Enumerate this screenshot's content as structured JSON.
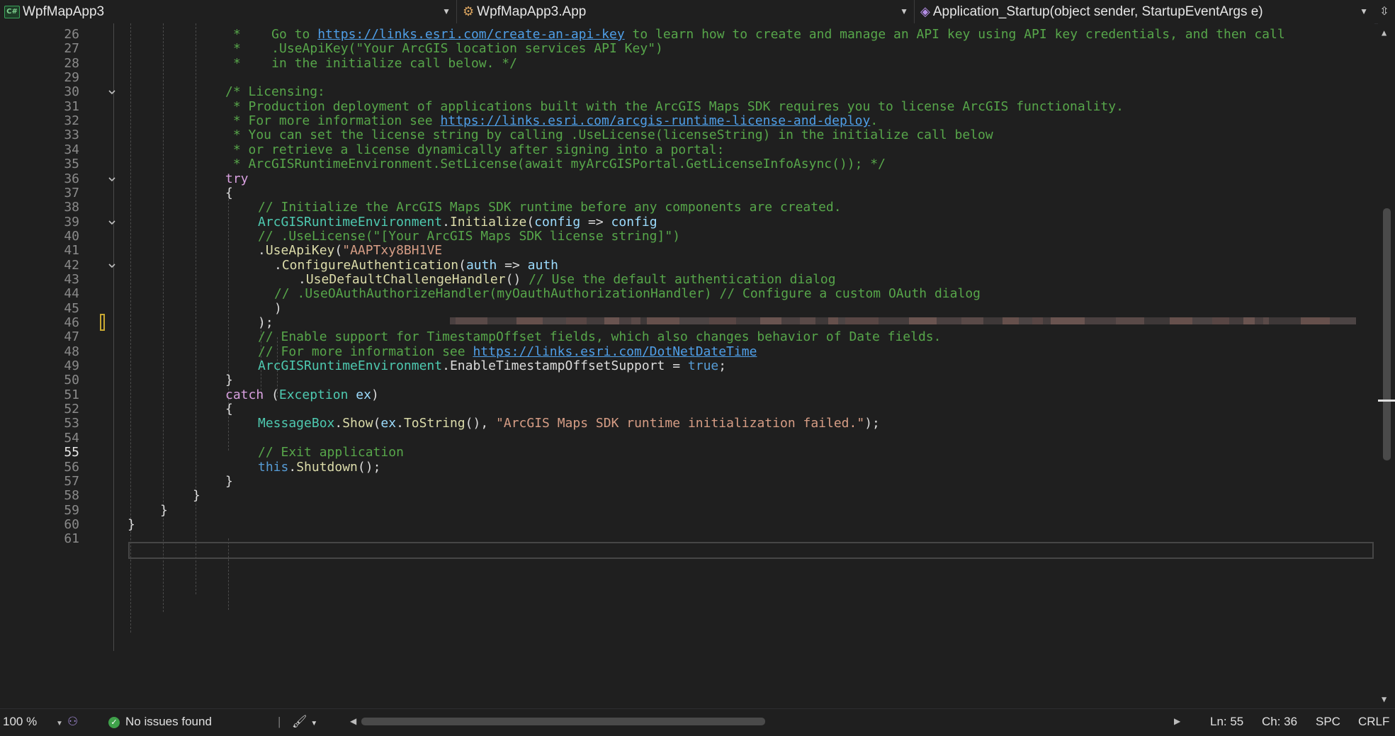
{
  "navbar": {
    "project": "WpfMapApp3",
    "project_icon": "C#",
    "class": "WpfMapApp3.App",
    "member": "Application_Startup(object sender, StartupEventArgs e)"
  },
  "lines": [
    {
      "n": "26",
      "text": "*    Go to https://links.esri.com/create-an-api-key to learn how to create and manage an API key using API key credentials, and then call"
    },
    {
      "n": "27",
      "text": "*    .UseApiKey(\"Your ArcGIS location services API Key\")"
    },
    {
      "n": "28",
      "text": "*    in the initialize call below. */"
    },
    {
      "n": "29",
      "text": ""
    },
    {
      "n": "30",
      "text": "/* Licensing:"
    },
    {
      "n": "31",
      "text": " * Production deployment of applications built with the ArcGIS Maps SDK requires you to license ArcGIS functionality."
    },
    {
      "n": "32",
      "text": " * For more information see https://links.esri.com/arcgis-runtime-license-and-deploy."
    },
    {
      "n": "33",
      "text": " * You can set the license string by calling .UseLicense(licenseString) in the initialize call below"
    },
    {
      "n": "34",
      "text": " * or retrieve a license dynamically after signing into a portal:"
    },
    {
      "n": "35",
      "text": " * ArcGISRuntimeEnvironment.SetLicense(await myArcGISPortal.GetLicenseInfoAsync()); */"
    },
    {
      "n": "36",
      "text": "try"
    },
    {
      "n": "37",
      "text": "{"
    },
    {
      "n": "38",
      "text": "// Initialize the ArcGIS Maps SDK runtime before any components are created."
    },
    {
      "n": "39",
      "text": "ArcGISRuntimeEnvironment.Initialize(config => config"
    },
    {
      "n": "40",
      "text": "// .UseLicense(\"[Your ArcGIS Maps SDK license string]\")"
    },
    {
      "n": "41",
      "text": ".UseApiKey(\"AAPTxy8BH1VE"
    },
    {
      "n": "42",
      "text": ".ConfigureAuthentication(auth => auth"
    },
    {
      "n": "43",
      "text": ".UseDefaultChallengeHandler() // Use the default authentication dialog"
    },
    {
      "n": "44",
      "text": "// .UseOAuthAuthorizeHandler(myOauthAuthorizationHandler) // Configure a custom OAuth dialog"
    },
    {
      "n": "45",
      "text": ")"
    },
    {
      "n": "46",
      "text": ");"
    },
    {
      "n": "47",
      "text": "// Enable support for TimestampOffset fields, which also changes behavior of Date fields."
    },
    {
      "n": "48",
      "text": "// For more information see https://links.esri.com/DotNetDateTime"
    },
    {
      "n": "49",
      "text": "ArcGISRuntimeEnvironment.EnableTimestampOffsetSupport = true;"
    },
    {
      "n": "50",
      "text": "}"
    },
    {
      "n": "51",
      "text": "catch (Exception ex)"
    },
    {
      "n": "52",
      "text": "{"
    },
    {
      "n": "53",
      "text": "MessageBox.Show(ex.ToString(), \"ArcGIS Maps SDK runtime initialization failed.\");"
    },
    {
      "n": "54",
      "text": ""
    },
    {
      "n": "55",
      "text": "// Exit application"
    },
    {
      "n": "56",
      "text": "this.Shutdown();"
    },
    {
      "n": "57",
      "text": "}"
    },
    {
      "n": "58",
      "text": "}"
    },
    {
      "n": "59",
      "text": "}"
    },
    {
      "n": "60",
      "text": "}"
    },
    {
      "n": "61",
      "text": ""
    }
  ],
  "current_line": "55",
  "status": {
    "zoom": "100 %",
    "issues": "No issues found",
    "ln": "Ln: 55",
    "ch": "Ch: 36",
    "spc": "SPC",
    "crlf": "CRLF"
  },
  "colors": {
    "keyword": "#d8a0df",
    "comment": "#57a64a",
    "string": "#d69d85",
    "type": "#4ec9b0",
    "method": "#dcdcaa",
    "link": "#4f9fe8"
  }
}
